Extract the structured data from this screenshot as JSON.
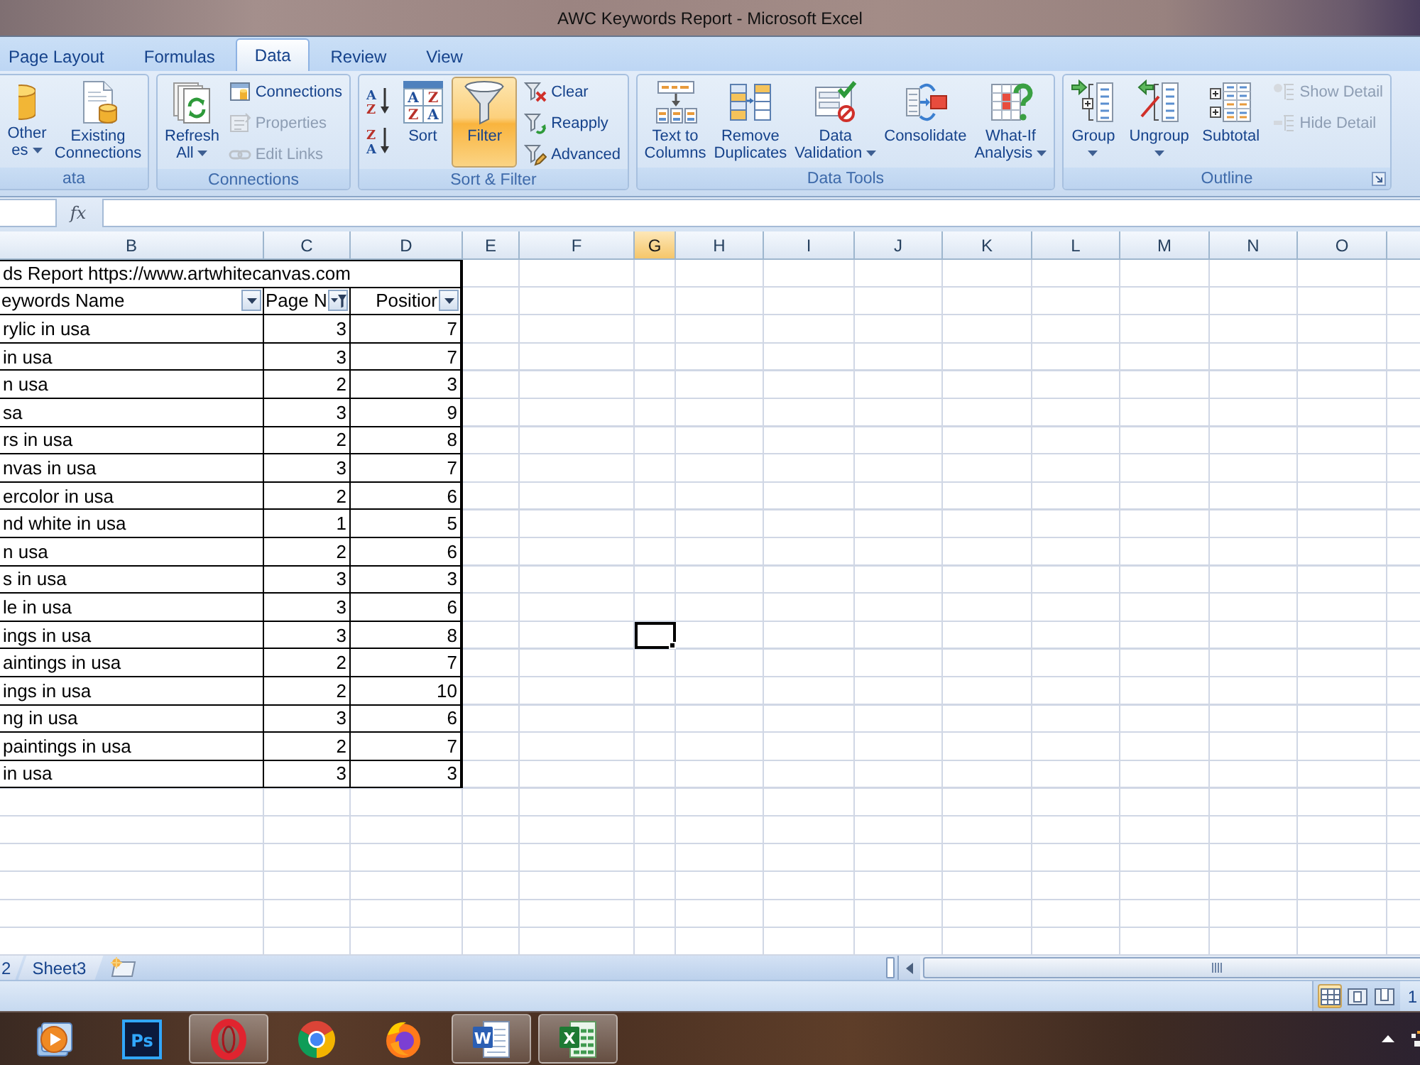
{
  "window": {
    "title": "AWC Keywords Report - Microsoft Excel"
  },
  "ribbon": {
    "tabs": [
      {
        "label": "Page Layout",
        "selected": false
      },
      {
        "label": "Formulas",
        "selected": false
      },
      {
        "label": "Data",
        "selected": true
      },
      {
        "label": "Review",
        "selected": false
      },
      {
        "label": "View",
        "selected": false
      }
    ],
    "groups": [
      {
        "label": "ata",
        "launcher": false,
        "commands": [
          {
            "kind": "large",
            "lines": [
              "Other",
              "es"
            ],
            "dropdown": true,
            "disabled": false,
            "on": false
          },
          {
            "kind": "large",
            "lines": [
              "Existing",
              "Connections"
            ],
            "dropdown": false,
            "disabled": false,
            "on": false
          }
        ]
      },
      {
        "label": "Connections",
        "launcher": false,
        "commands": [
          {
            "kind": "large",
            "lines": [
              "Refresh",
              "All"
            ],
            "dropdown": true,
            "disabled": false,
            "on": false
          },
          {
            "kind": "small",
            "lines": [
              "Connections"
            ],
            "dropdown": false,
            "disabled": false,
            "on": false
          },
          {
            "kind": "small",
            "lines": [
              "Properties"
            ],
            "dropdown": false,
            "disabled": true,
            "on": false
          },
          {
            "kind": "small",
            "lines": [
              "Edit Links"
            ],
            "dropdown": false,
            "disabled": true,
            "on": false
          }
        ]
      },
      {
        "label": "Sort & Filter",
        "launcher": false,
        "commands": [
          {
            "kind": "icon",
            "icon_text": [
              "A",
              "Z"
            ],
            "dropdown": false,
            "disabled": false,
            "on": false
          },
          {
            "kind": "icon",
            "icon_text": [
              "Z",
              "A"
            ],
            "dropdown": false,
            "disabled": false,
            "on": false
          },
          {
            "kind": "large",
            "lines": [
              "Sort"
            ],
            "icon_text": [
              "A",
              "Z",
              "Z",
              "A"
            ],
            "dropdown": false,
            "disabled": false,
            "on": false
          },
          {
            "kind": "large",
            "lines": [
              "Filter"
            ],
            "dropdown": false,
            "disabled": false,
            "on": true
          },
          {
            "kind": "small",
            "lines": [
              "Clear"
            ],
            "dropdown": false,
            "disabled": false,
            "on": false
          },
          {
            "kind": "small",
            "lines": [
              "Reapply"
            ],
            "dropdown": false,
            "disabled": false,
            "on": false
          },
          {
            "kind": "small",
            "lines": [
              "Advanced"
            ],
            "dropdown": false,
            "disabled": false,
            "on": false
          }
        ]
      },
      {
        "label": "Data Tools",
        "launcher": false,
        "commands": [
          {
            "kind": "large",
            "lines": [
              "Text to",
              "Columns"
            ],
            "dropdown": false,
            "disabled": false,
            "on": false
          },
          {
            "kind": "large",
            "lines": [
              "Remove",
              "Duplicates"
            ],
            "dropdown": false,
            "disabled": false,
            "on": false
          },
          {
            "kind": "large",
            "lines": [
              "Data",
              "Validation"
            ],
            "dropdown": true,
            "disabled": false,
            "on": false
          },
          {
            "kind": "large",
            "lines": [
              "Consolidate"
            ],
            "dropdown": false,
            "disabled": false,
            "on": false
          },
          {
            "kind": "large",
            "lines": [
              "What-If",
              "Analysis"
            ],
            "dropdown": true,
            "disabled": false,
            "on": false
          }
        ]
      },
      {
        "label": "Outline",
        "launcher": true,
        "commands": [
          {
            "kind": "large",
            "lines": [
              "Group"
            ],
            "dropdown": true,
            "disabled": false,
            "on": false
          },
          {
            "kind": "large",
            "lines": [
              "Ungroup"
            ],
            "dropdown": true,
            "disabled": false,
            "on": false
          },
          {
            "kind": "large",
            "lines": [
              "Subtotal"
            ],
            "dropdown": false,
            "disabled": false,
            "on": false
          },
          {
            "kind": "small",
            "lines": [
              "Show Detail"
            ],
            "dropdown": false,
            "disabled": true,
            "on": false
          },
          {
            "kind": "small",
            "lines": [
              "Hide Detail"
            ],
            "dropdown": false,
            "disabled": true,
            "on": false
          }
        ]
      }
    ]
  },
  "formula_bar": {
    "function_label": "fx"
  },
  "sheet": {
    "columns": [
      {
        "label": "B",
        "selected": false
      },
      {
        "label": "C",
        "selected": false
      },
      {
        "label": "D",
        "selected": false
      },
      {
        "label": "E",
        "selected": false
      },
      {
        "label": "F",
        "selected": false
      },
      {
        "label": "G",
        "selected": true
      },
      {
        "label": "H",
        "selected": false
      },
      {
        "label": "I",
        "selected": false
      },
      {
        "label": "J",
        "selected": false
      },
      {
        "label": "K",
        "selected": false
      },
      {
        "label": "L",
        "selected": false
      },
      {
        "label": "M",
        "selected": false
      },
      {
        "label": "N",
        "selected": false
      },
      {
        "label": "O",
        "selected": false
      }
    ],
    "title": "ds Report https://www.artwhitecanvas.com",
    "headers": [
      {
        "label": "eywords Name",
        "filtered": false
      },
      {
        "label": "Page N",
        "filtered": true
      },
      {
        "label": "Positior",
        "filtered": false
      }
    ],
    "rows": [
      {
        "cells": [
          "rylic in usa",
          "3",
          "7"
        ],
        "selected": false
      },
      {
        "cells": [
          "in usa",
          "3",
          "7"
        ],
        "selected": false
      },
      {
        "cells": [
          "n usa",
          "2",
          "3"
        ],
        "selected": false
      },
      {
        "cells": [
          "sa",
          "3",
          "9"
        ],
        "selected": false
      },
      {
        "cells": [
          "rs in usa",
          "2",
          "8"
        ],
        "selected": false
      },
      {
        "cells": [
          "nvas in usa",
          "3",
          "7"
        ],
        "selected": false
      },
      {
        "cells": [
          "ercolor in usa",
          "2",
          "6"
        ],
        "selected": false
      },
      {
        "cells": [
          "nd white in usa",
          "1",
          "5"
        ],
        "selected": false
      },
      {
        "cells": [
          "n usa",
          "2",
          "6"
        ],
        "selected": false
      },
      {
        "cells": [
          "s in usa",
          "3",
          "3"
        ],
        "selected": false
      },
      {
        "cells": [
          "le in usa",
          "3",
          "6"
        ],
        "selected": false
      },
      {
        "cells": [
          "ings in usa",
          "3",
          "8"
        ],
        "selected": true
      },
      {
        "cells": [
          "aintings in usa",
          "2",
          "7"
        ],
        "selected": false
      },
      {
        "cells": [
          "ings in usa",
          "2",
          "10"
        ],
        "selected": false
      },
      {
        "cells": [
          "ng in usa",
          "3",
          "6"
        ],
        "selected": false
      },
      {
        "cells": [
          "paintings in usa",
          "2",
          "7"
        ],
        "selected": false
      },
      {
        "cells": [
          "in usa",
          "3",
          "3"
        ],
        "selected": false
      }
    ]
  },
  "sheet_tabs": [
    {
      "label": "2",
      "selected": false
    },
    {
      "label": "Sheet3",
      "selected": false
    }
  ],
  "status_bar": {
    "view_buttons": [
      {
        "selected": true
      },
      {
        "selected": false
      },
      {
        "selected": false
      }
    ],
    "zoom": "1"
  },
  "taskbar": {
    "apps": [
      {
        "running": false
      },
      {
        "running": false,
        "icon_text": "Ps"
      },
      {
        "running": true
      },
      {
        "running": false
      },
      {
        "running": false
      },
      {
        "running": true,
        "icon_text": "W"
      },
      {
        "running": true,
        "icon_text": "X"
      }
    ]
  }
}
